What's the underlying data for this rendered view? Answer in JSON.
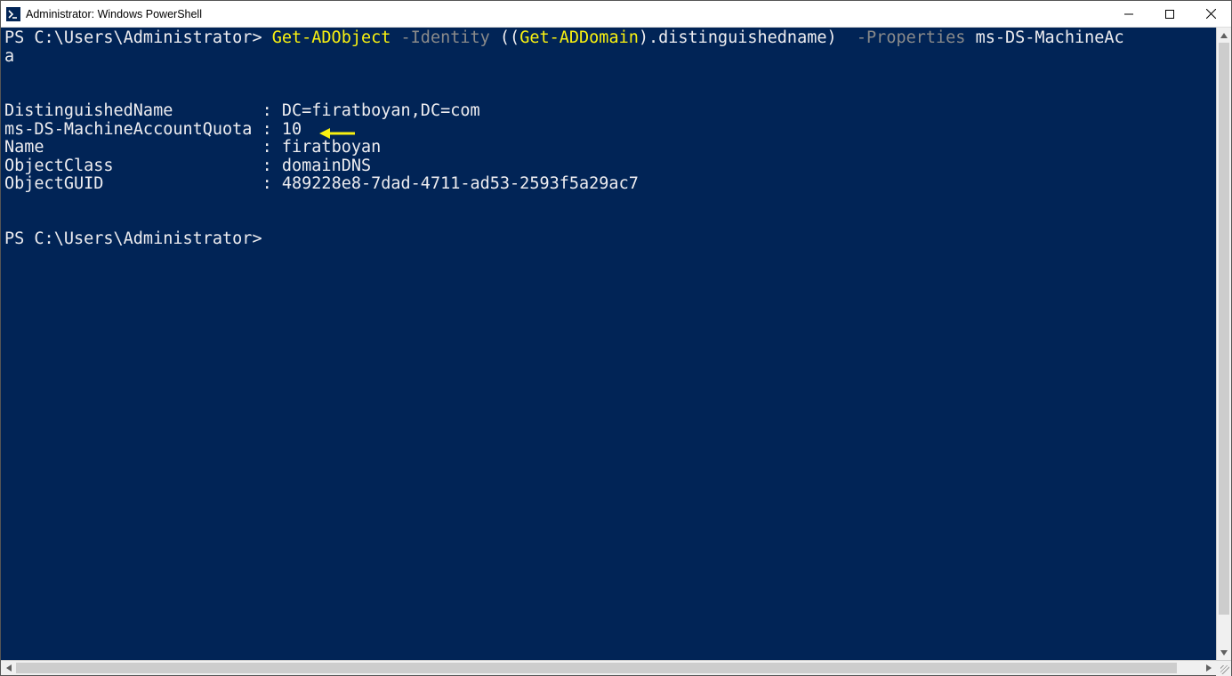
{
  "window": {
    "title": "Administrator: Windows PowerShell"
  },
  "terminal": {
    "prompt1_prefix": "PS C:\\Users\\Administrator> ",
    "cmd_part1": "Get-ADObject",
    "cmd_part2": " -Identity",
    "cmd_part3": " ((",
    "cmd_part4": "Get-ADDomain",
    "cmd_part5": ").distinguishedname)  ",
    "cmd_part6": "-Properties",
    "cmd_part7": " ms-DS-MachineAc",
    "cmd_wrap": "a",
    "blank1": "",
    "blank2": "",
    "rows": [
      {
        "label": "DistinguishedName        ",
        "sep": " : ",
        "value": "DC=firatboyan,DC=com"
      },
      {
        "label": "ms-DS-MachineAccountQuota",
        "sep": " : ",
        "value": "10"
      },
      {
        "label": "Name                     ",
        "sep": " : ",
        "value": "firatboyan"
      },
      {
        "label": "ObjectClass              ",
        "sep": " : ",
        "value": "domainDNS"
      },
      {
        "label": "ObjectGUID               ",
        "sep": " : ",
        "value": "489228e8-7dad-4711-ad53-2593f5a29ac7"
      }
    ],
    "blank3": "",
    "blank4": "",
    "prompt2": "PS C:\\Users\\Administrator>"
  },
  "annotation": {
    "arrow_color": "#f9f110"
  }
}
